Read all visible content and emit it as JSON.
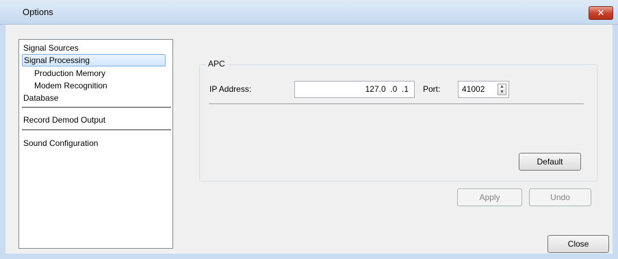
{
  "window": {
    "title": "Options",
    "close_glyph": "✕"
  },
  "nav": {
    "items": [
      {
        "label": "Signal Sources"
      },
      {
        "label": "Signal Processing"
      },
      {
        "label": "Production Memory"
      },
      {
        "label": "Modem Recognition"
      },
      {
        "label": "Database"
      },
      {
        "label": "Record Demod Output"
      },
      {
        "label": "Sound Configuration"
      }
    ],
    "selected": "Signal Processing"
  },
  "apc": {
    "group_label": "APC",
    "ip_label": "IP Address:",
    "ip_value": "127.0  .0  .1",
    "port_label": "Port:",
    "port_value": "41002",
    "default_label": "Default"
  },
  "footer": {
    "apply_label": "Apply",
    "undo_label": "Undo",
    "close_label": "Close"
  }
}
